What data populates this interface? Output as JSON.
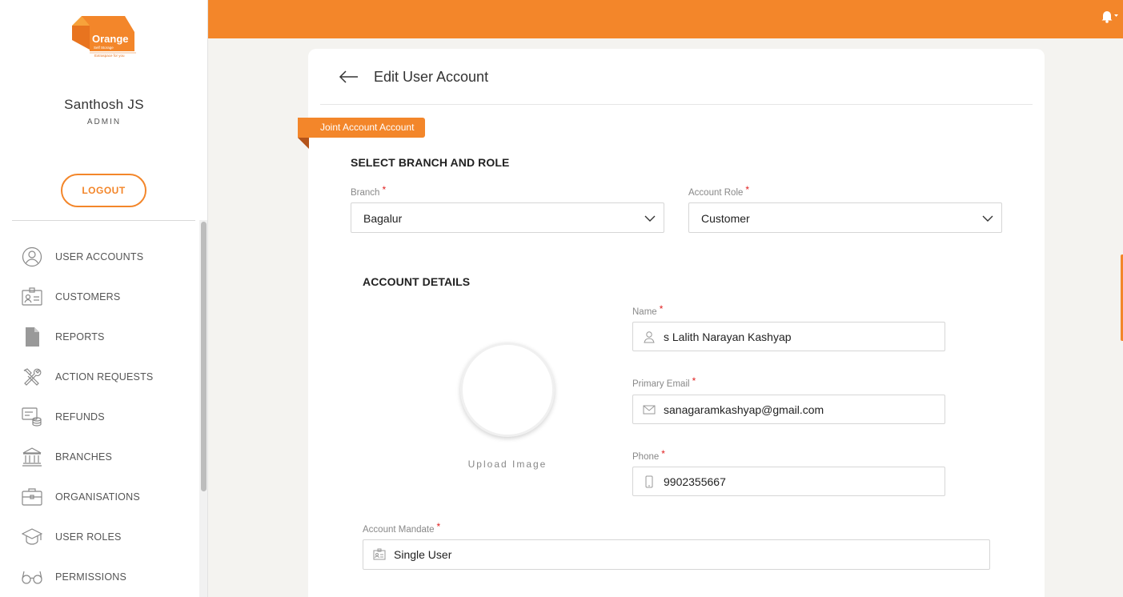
{
  "brand": {
    "logo_word": "Orange",
    "logo_sub": "Self Storage",
    "logo_tagline": "Extraspace for you",
    "accent_color": "#f3862a"
  },
  "user": {
    "name": "Santhosh JS",
    "role": "ADMIN"
  },
  "sidebar": {
    "logout_label": "LOGOUT",
    "items": [
      {
        "label": "USER ACCOUNTS",
        "icon": "user-circle-icon"
      },
      {
        "label": "CUSTOMERS",
        "icon": "id-card-icon"
      },
      {
        "label": "REPORTS",
        "icon": "document-icon"
      },
      {
        "label": "ACTION REQUESTS",
        "icon": "tools-icon"
      },
      {
        "label": "REFUNDS",
        "icon": "refund-icon"
      },
      {
        "label": "BRANCHES",
        "icon": "bank-icon"
      },
      {
        "label": "ORGANISATIONS",
        "icon": "briefcase-icon"
      },
      {
        "label": "USER ROLES",
        "icon": "graduation-cap-icon"
      },
      {
        "label": "PERMISSIONS",
        "icon": "glasses-icon"
      }
    ]
  },
  "topbar": {
    "notification_icon": "bell-icon"
  },
  "page": {
    "title": "Edit User Account",
    "ribbon": "Joint Account Account",
    "branch_section": {
      "title": "SELECT BRANCH AND ROLE",
      "branch_label": "Branch",
      "branch_value": "Bagalur",
      "role_label": "Account Role",
      "role_value": "Customer"
    },
    "account_section": {
      "title": "ACCOUNT DETAILS",
      "upload_label": "Upload Image",
      "name_label": "Name",
      "name_value": "s Lalith Narayan Kashyap",
      "email_label": "Primary Email",
      "email_value": "sanagaramkashyap@gmail.com",
      "phone_label": "Phone",
      "phone_value": "9902355667",
      "mandate_label": "Account Mandate",
      "mandate_value": "Single User"
    },
    "required_mark": "*"
  }
}
